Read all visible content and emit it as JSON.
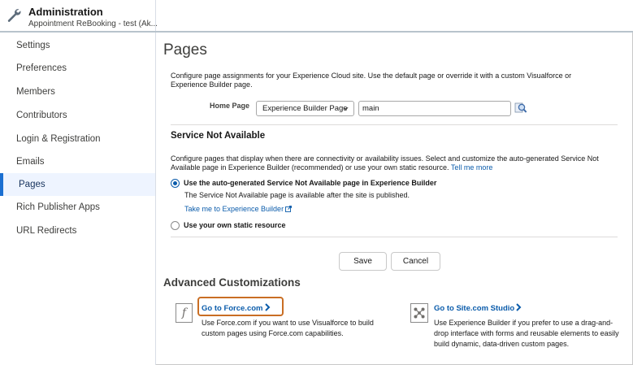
{
  "header": {
    "title": "Administration",
    "subtitle": "Appointment ReBooking - test (Ak..."
  },
  "sidebar": {
    "items": [
      {
        "label": "Settings",
        "active": false
      },
      {
        "label": "Preferences",
        "active": false
      },
      {
        "label": "Members",
        "active": false
      },
      {
        "label": "Contributors",
        "active": false
      },
      {
        "label": "Login & Registration",
        "active": false
      },
      {
        "label": "Emails",
        "active": false
      },
      {
        "label": "Pages",
        "active": true
      },
      {
        "label": "Rich Publisher Apps",
        "active": false
      },
      {
        "label": "URL Redirects",
        "active": false
      }
    ]
  },
  "main": {
    "title": "Pages",
    "intro": "Configure page assignments for your Experience Cloud site. Use the default page or override it with a custom Visualforce or Experience Builder page.",
    "home_page": {
      "label": "Home Page",
      "select_value": "Experience Builder Page",
      "input_value": "main"
    },
    "service_not_available": {
      "title": "Service Not Available",
      "description": "Configure pages that display when there are connectivity or availability issues. Select and customize the auto-generated Service Not Available page in Experience Builder (recommended) or use your own static resource.",
      "tell_me_more": "Tell me more",
      "option_auto": "Use the auto-generated Service Not Available page in Experience Builder",
      "option_auto_note": "The Service Not Available page is available after the site is published.",
      "take_me_link": "Take me to Experience Builder",
      "option_static": "Use your own static resource",
      "selected": "auto"
    },
    "buttons": {
      "save": "Save",
      "cancel": "Cancel"
    },
    "advanced": {
      "title": "Advanced Customizations",
      "force": {
        "icon_glyph": "f",
        "link": "Go to Force.com",
        "description": "Use Force.com if you want to use Visualforce to build custom pages using Force.com capabilities."
      },
      "site": {
        "link": "Go to Site.com Studio",
        "description": "Use Experience Builder if you prefer to use a drag-and-drop interface with forms and reusable elements to easily build dynamic, data-driven custom pages."
      }
    }
  },
  "colors": {
    "link": "#0b5cab",
    "active_indicator": "#1b6fd1",
    "highlight_border": "#c96e24"
  }
}
